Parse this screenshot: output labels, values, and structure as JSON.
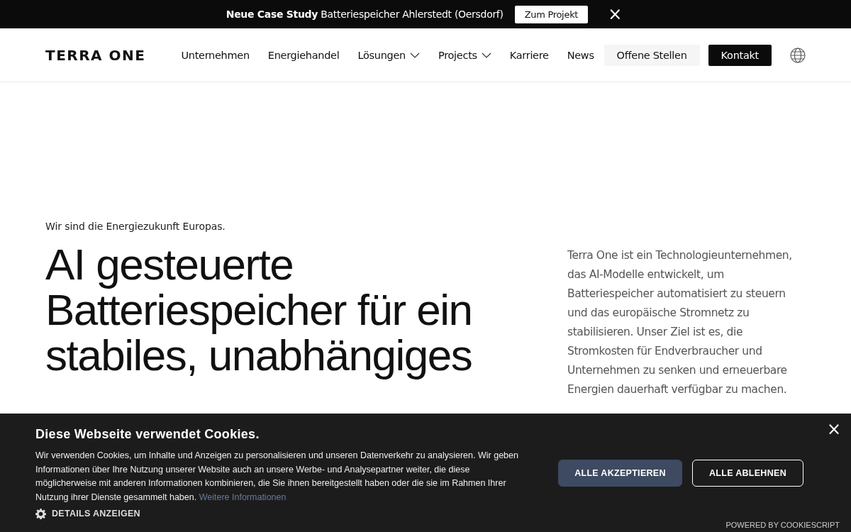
{
  "announcement": {
    "label": "Neue Case Study",
    "text": "Batteriespeicher Ahlerstedt (Oersdorf)",
    "button": "Zum Projekt",
    "close": "×"
  },
  "nav": {
    "logo": "TERRA ONE",
    "items": [
      {
        "label": "Unternehmen",
        "dropdown": false
      },
      {
        "label": "Energiehandel",
        "dropdown": false
      },
      {
        "label": "Lösungen",
        "dropdown": true
      },
      {
        "label": "Projects",
        "dropdown": true
      },
      {
        "label": "Karriere",
        "dropdown": false
      },
      {
        "label": "News",
        "dropdown": false
      }
    ],
    "buttons": [
      {
        "label": "Offene Stellen",
        "kind": "secondary"
      },
      {
        "label": "Kontakt",
        "kind": "primary"
      }
    ]
  },
  "hero": {
    "tagline": "Wir sind die Energiezukunft Europas.",
    "headline": "AI gesteuerte Batteriespeicher für ein stabiles, unabhängiges",
    "description": "Terra One ist ein Technologieunternehmen, das AI-Modelle entwickelt, um Batteriespeicher automatisiert zu steuern und das europäische Stromnetz zu stabilisieren. Unser Ziel ist es, die Stromkosten für Endverbraucher und Unternehmen zu senken und erneuerbare Energien dauerhaft verfügbar zu machen."
  },
  "cookie_banner": {
    "title": "Diese Webseite verwendet Cookies.",
    "text": "Wir verwenden Cookies, um Inhalte und Anzeigen zu personalisieren und unseren Datenverkehr zu analysieren. Wir geben Informationen über Ihre Nutzung unserer Website auch an unsere Werbe- und Analysepartner weiter, die diese möglicherweise mit anderen Informationen kombinieren, die Sie ihnen bereitgestellt haben oder die sie im Rahmen Ihrer Nutzung ihrer Dienste gesammelt haben.",
    "link": "Weitere Informationen",
    "details": "DETAILS ANZEIGEN",
    "buttons": [
      {
        "label": "ALLE AKZEPTIEREN",
        "kind": "primary"
      },
      {
        "label": "ALLE ABLEHNEN",
        "kind": "outline"
      }
    ],
    "close": "×",
    "powered_by": "POWERED BY COOKIESCRIPT"
  }
}
